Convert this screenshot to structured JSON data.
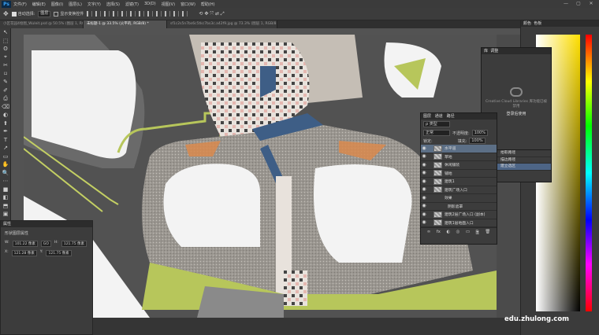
{
  "app": {
    "logo": "Ps"
  },
  "menu": [
    "文件(F)",
    "编辑(E)",
    "图像(I)",
    "图层(L)",
    "文字(Y)",
    "选择(S)",
    "滤镜(T)",
    "3D(D)",
    "视图(V)",
    "窗口(W)",
    "帮助(H)"
  ],
  "window_controls": [
    "—",
    "▢",
    "✕"
  ],
  "options": {
    "auto_select": "自动选择:",
    "target": "图层",
    "show_transform": "显示变换控件"
  },
  "tabs": [
    {
      "label": "小区花园4绘图_Wuleit.psd @ 50.5% (图层 1, RGB/8) *"
    },
    {
      "label": "未标题-1 @ 33.5% (火平的, RGB/8) *"
    },
    {
      "label": "sf1c2s5n7bs6c5tkc7bs3c.a42f9.jpg @ 73.3% (图层 1, RGB/8#)"
    }
  ],
  "tools": [
    "↖",
    "⬚",
    "ʘ",
    "⌖",
    "✂",
    "⌑",
    "✎",
    "✐",
    "⎙",
    "⌫",
    "◐",
    "⬆",
    "✒",
    "T",
    "↗",
    "▭",
    "✋",
    "🔍",
    "⋯",
    "■",
    "◧",
    "⬒",
    "▣"
  ],
  "properties_panel": {
    "title": "属性",
    "subtitle": "形状图层属性",
    "w_label": "W:",
    "w_value": "101.22 像素",
    "h_label": "H:",
    "h_value": "121.75 像素",
    "x_label": "X:",
    "x_value": "121.28 像素",
    "y_label": "Y:",
    "y_value": "121.75 像素",
    "link": "GO"
  },
  "cc_panel": {
    "tabs": [
      "库",
      "调整"
    ],
    "message": "Creative Cloud Libraries 库功能已被禁用",
    "link": "登录后使用"
  },
  "layers_panel": {
    "tabs": [
      "图层",
      "通道",
      "路径"
    ],
    "kind": "ρ 类型",
    "blend": "正常",
    "opacity_label": "不透明度:",
    "opacity": "100%",
    "lock_label": "锁定:",
    "fill_label": "填充:",
    "fill": "100%",
    "layers": [
      {
        "name": "水平道",
        "selected": true
      },
      {
        "name": "草地"
      },
      {
        "name": "休闲铺装"
      },
      {
        "name": "铺地"
      },
      {
        "name": "建筑1"
      },
      {
        "name": "建筑广场入口"
      },
      {
        "name": "效果"
      },
      {
        "name": "阴影遮罩"
      },
      {
        "name": "建筑2层广场入口 (副本)"
      },
      {
        "name": "建筑1层地面入口"
      }
    ],
    "bottom_icons": [
      "∞",
      "fx",
      "◐",
      "◎",
      "▭",
      "🗎",
      "🗑"
    ]
  },
  "paths_panel": {
    "rows": [
      {
        "label": "拾取路径"
      },
      {
        "label": "描边路径"
      },
      {
        "label": "建立选区",
        "selected": true
      }
    ]
  },
  "right_dock": {
    "tabs": [
      "颜色",
      "色板"
    ]
  },
  "watermark": "edu.zhulong.com",
  "accent_colors": {
    "grass": "#b7c65b",
    "water": "#3e5e86",
    "orange": "#d98a4d",
    "road": "#454545"
  }
}
